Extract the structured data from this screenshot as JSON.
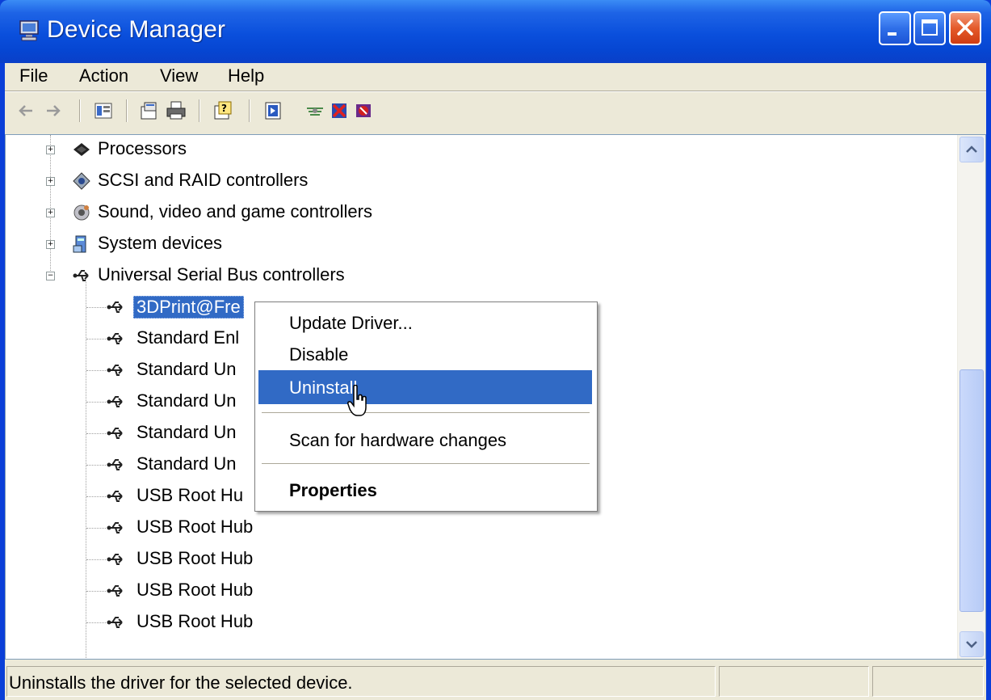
{
  "window": {
    "title": "Device Manager",
    "icon": "computer-monitor-icon"
  },
  "menubar": {
    "items": [
      "File",
      "Action",
      "View",
      "Help"
    ]
  },
  "toolbar": {
    "tools": [
      "back-arrow-icon",
      "forward-arrow-icon",
      "show-hide-console-tree-icon",
      "properties-icon",
      "print-icon",
      "help-icon",
      "update-driver-icon",
      "scan-hardware-icon",
      "uninstall-icon",
      "disable-icon"
    ]
  },
  "tree": {
    "categories": [
      {
        "label": "Processors",
        "icon": "processor-icon",
        "expanded": false
      },
      {
        "label": "SCSI and RAID controllers",
        "icon": "scsi-icon",
        "expanded": false
      },
      {
        "label": "Sound, video and game controllers",
        "icon": "sound-icon",
        "expanded": false
      },
      {
        "label": "System devices",
        "icon": "system-devices-icon",
        "expanded": false
      },
      {
        "label": "Universal Serial Bus controllers",
        "icon": "usb-icon",
        "expanded": true
      }
    ],
    "usb_children": [
      {
        "label": "3DPrint@Fre",
        "selected": true
      },
      {
        "label": "Standard Enl"
      },
      {
        "label": "Standard Un"
      },
      {
        "label": "Standard Un"
      },
      {
        "label": "Standard Un"
      },
      {
        "label": "Standard Un"
      },
      {
        "label": "USB Root Hu"
      },
      {
        "label": "USB Root Hub"
      },
      {
        "label": "USB Root Hub"
      },
      {
        "label": "USB Root Hub"
      },
      {
        "label": "USB Root Hub"
      }
    ]
  },
  "context_menu": {
    "items": [
      {
        "label": "Update Driver..."
      },
      {
        "label": "Disable"
      },
      {
        "label": "Uninstall",
        "highlighted": true
      },
      {
        "label": "Scan for hardware changes"
      },
      {
        "label": "Properties",
        "bold": true
      }
    ]
  },
  "statusbar": {
    "text": "Uninstalls the driver for the selected device."
  },
  "colors": {
    "titlebar": "#0a4fdc",
    "selection": "#316ac5",
    "frame": "#ece9d8"
  }
}
